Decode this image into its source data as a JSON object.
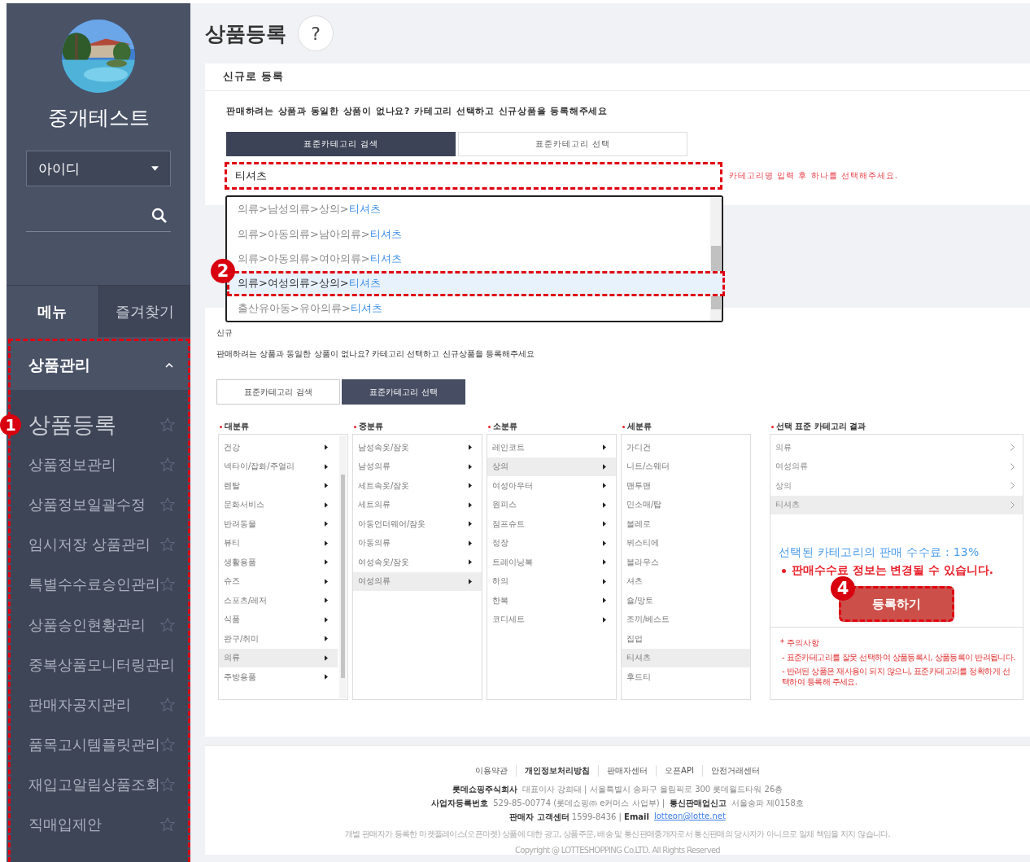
{
  "sidebar": {
    "store_name": "중개테스트",
    "select": {
      "value": "아이디"
    },
    "tabs": [
      {
        "label": "메뉴",
        "selected": true
      },
      {
        "label": "즐겨찾기",
        "selected": false
      }
    ],
    "step_badge": "1",
    "section": {
      "title": "상품관리",
      "expanded": true,
      "items": [
        {
          "label": "상품등록",
          "selected": true
        },
        {
          "label": "상품정보관리",
          "selected": false
        },
        {
          "label": "상품정보일괄수정",
          "selected": false
        },
        {
          "label": "임시저장 상품관리",
          "selected": false
        },
        {
          "label": "특별수수료승인관리",
          "selected": false
        },
        {
          "label": "상품승인현황관리",
          "selected": false
        },
        {
          "label": "중복상품모니터링관리",
          "selected": false
        },
        {
          "label": "판매자공지관리",
          "selected": false
        },
        {
          "label": "품목고시템플릿관리",
          "selected": false
        },
        {
          "label": "재입고알림상품조회",
          "selected": false
        },
        {
          "label": "직매입제안",
          "selected": false
        }
      ]
    }
  },
  "page_title": "상품등록",
  "help": "?",
  "search_card": {
    "title": "신규로 등록",
    "description": "판매하려는 상품과 동일한 상품이 없나요? 카테고리 선택하고 신규상품을 등록해주세요",
    "tabs": [
      {
        "label": "표준카테고리 검색",
        "selected": true
      },
      {
        "label": "표준카테고리 선택",
        "selected": false
      }
    ],
    "input": {
      "value": "티셔츠"
    },
    "hint": "카테고리명 입력 후 하나를 선택해주세요.",
    "dropdown": {
      "step_badge": "2",
      "items": [
        {
          "path": "의류>남성의류>상의>",
          "match": "티셔츠",
          "selected": false
        },
        {
          "path": "의류>아동의류>남아의류>",
          "match": "티셔츠",
          "selected": false
        },
        {
          "path": "의류>아동의류>여아의류>",
          "match": "티셔츠",
          "selected": false
        },
        {
          "path": "의류>여성의류>상의>",
          "match": "티셔츠",
          "selected": true
        },
        {
          "path": "출산유아동>유아의류>",
          "match": "티셔츠",
          "selected": false
        }
      ]
    }
  },
  "select_card": {
    "title": "신규",
    "description": "판매하려는 상품과 동일한 상품이 없나요? 카테고리 선택하고 신규상품을 등록해주세요",
    "tabs": [
      {
        "label": "표준카테고리 검색",
        "selected": false
      },
      {
        "label": "표준카테고리 선택",
        "selected": true
      }
    ],
    "columns": [
      {
        "title": "대분류",
        "kind": "branch",
        "items": [
          {
            "label": "건강",
            "selected": false
          },
          {
            "label": "넥타이/잡화/주얼리",
            "selected": false
          },
          {
            "label": "렌탈",
            "selected": false
          },
          {
            "label": "문화서비스",
            "selected": false
          },
          {
            "label": "반려동물",
            "selected": false
          },
          {
            "label": "뷰티",
            "selected": false
          },
          {
            "label": "생활용품",
            "selected": false
          },
          {
            "label": "슈즈",
            "selected": false
          },
          {
            "label": "스포츠/레저",
            "selected": false
          },
          {
            "label": "식품",
            "selected": false
          },
          {
            "label": "완구/취미",
            "selected": false
          },
          {
            "label": "의류",
            "selected": true
          },
          {
            "label": "주방용품",
            "selected": false
          }
        ]
      },
      {
        "title": "중분류",
        "kind": "branch",
        "items": [
          {
            "label": "남성속옷/잠옷",
            "selected": false
          },
          {
            "label": "남성의류",
            "selected": false
          },
          {
            "label": "세트속옷/잠옷",
            "selected": false
          },
          {
            "label": "세트의류",
            "selected": false
          },
          {
            "label": "아동언더웨어/잠옷",
            "selected": false
          },
          {
            "label": "아동의류",
            "selected": false
          },
          {
            "label": "여성속옷/잠옷",
            "selected": false
          },
          {
            "label": "여성의류",
            "selected": true
          }
        ]
      },
      {
        "title": "소분류",
        "kind": "branch",
        "items": [
          {
            "label": "레인코트",
            "selected": false
          },
          {
            "label": "상의",
            "selected": true
          },
          {
            "label": "여성아우터",
            "selected": false
          },
          {
            "label": "원피스",
            "selected": false
          },
          {
            "label": "점프슈트",
            "selected": false
          },
          {
            "label": "정장",
            "selected": false
          },
          {
            "label": "트레이닝복",
            "selected": false
          },
          {
            "label": "하의",
            "selected": false
          },
          {
            "label": "한복",
            "selected": false
          },
          {
            "label": "코디세트",
            "selected": false
          }
        ]
      },
      {
        "title": "세분류",
        "kind": "leaf",
        "items": [
          {
            "label": "가디건",
            "selected": false
          },
          {
            "label": "니트/스웨터",
            "selected": false
          },
          {
            "label": "맨투맨",
            "selected": false
          },
          {
            "label": "민소매/탑",
            "selected": false
          },
          {
            "label": "볼레로",
            "selected": false
          },
          {
            "label": "뷔스티에",
            "selected": false
          },
          {
            "label": "블라우스",
            "selected": false
          },
          {
            "label": "셔츠",
            "selected": false
          },
          {
            "label": "숄/망토",
            "selected": false
          },
          {
            "label": "조끼/베스트",
            "selected": false
          },
          {
            "label": "집업",
            "selected": false
          },
          {
            "label": "티셔츠",
            "selected": true
          },
          {
            "label": "후드티",
            "selected": false
          }
        ]
      }
    ],
    "result": {
      "title": "선택 표준 카테고리 결과",
      "items": [
        {
          "label": "의류",
          "selected": false
        },
        {
          "label": "여성의류",
          "selected": false
        },
        {
          "label": "상의",
          "selected": false
        },
        {
          "label": "티셔츠",
          "selected": true
        }
      ],
      "fee": "선택된 카테고리의 판매 수수료 : 13%",
      "warning": "판매수수료 정보는 변경될 수 있습니다.",
      "step_badge": "4",
      "button": "등록하기",
      "notice_title": "* 주의사항",
      "notices": [
        "- 표준카테고리를 잘못 선택하여 상품등록시, 상품등록이 반려됩니다.",
        "- 반려된 상품은 재사용이 되지 않으니, 표준카테고리를 정확하게 선택하여 등록해 주세요."
      ]
    }
  },
  "footer": {
    "links": [
      "이용약관",
      "개인정보처리방침",
      "판매자센터",
      "오픈API",
      "안전거래센터"
    ],
    "info": [
      "**롯데쇼핑주식회사** 대표이사 강희태 | 서울특별시 송파구 올림픽로 300 롯데월드타워 26층",
      "**사업자등록번호** 529-85-00774 (롯데쇼핑㈜ e커머스 사업부) | **통신판매업신고** 서울송파 제0158호"
    ],
    "contact": "**판매자 고객센터** 1599-8436 | **Email**",
    "email": "lotteon@lotte.net",
    "disclaimer": "개별 판매자가 등록한 마켓플레이스(오픈마켓) 상품에 대한 광고, 상품주문, 배송 및 통신판매중개자로서 통신판매의 당사자가 아니므로 일체 책임을 지지 않습니다.",
    "copyright": "Copyright @ LOTTESHOPPING Co.LTD. All Rights Reserved"
  }
}
